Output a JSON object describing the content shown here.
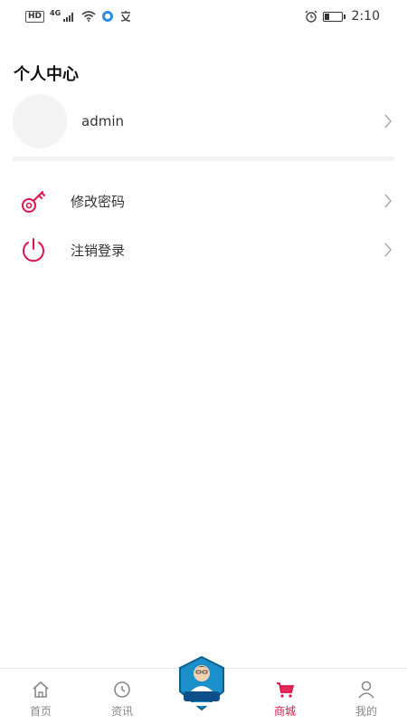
{
  "status_bar": {
    "hd": "HD",
    "network": "4G",
    "time": "2:10",
    "battery_level": 0.35
  },
  "page": {
    "title": "个人中心"
  },
  "profile": {
    "username": "admin"
  },
  "menu": [
    {
      "label": "修改密码",
      "icon": "key-icon"
    },
    {
      "label": "注销登录",
      "icon": "power-icon"
    }
  ],
  "colors": {
    "accent": "#e0144a",
    "divider": "#f2f2f2",
    "avatar_bg": "#f3f3f3"
  },
  "tabbar": {
    "tabs": [
      {
        "label": "首页",
        "icon": "home-icon"
      },
      {
        "label": "资讯",
        "icon": "news-icon"
      },
      {
        "label": "",
        "icon": "doctor-logo"
      },
      {
        "label": "商城",
        "icon": "cart-icon",
        "active": true
      },
      {
        "label": "我的",
        "icon": "user-icon"
      }
    ]
  }
}
